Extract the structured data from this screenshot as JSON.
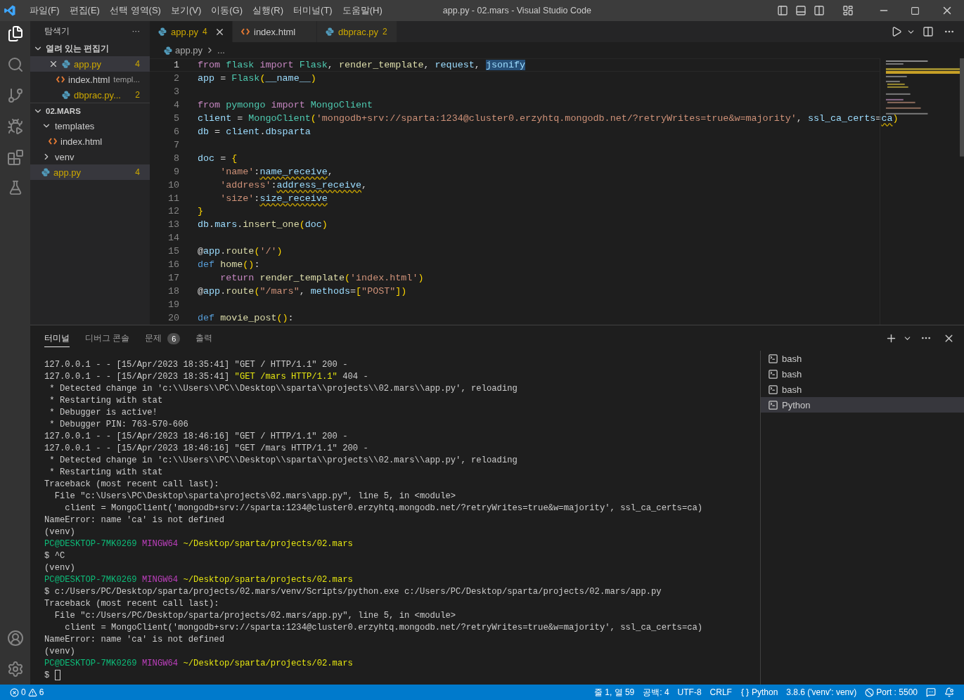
{
  "window": {
    "title": "app.py - 02.mars - Visual Studio Code"
  },
  "menu": [
    "파일(F)",
    "편집(E)",
    "선택 영역(S)",
    "보기(V)",
    "이동(G)",
    "실행(R)",
    "터미널(T)",
    "도움말(H)"
  ],
  "sidebar": {
    "title": "탐색기",
    "more": "···",
    "open_editors": {
      "title": "열려 있는 편집기",
      "expanded": true,
      "items": [
        {
          "label": "app.py",
          "kind": "python",
          "badge": "4",
          "warning": true,
          "closable": true,
          "selected": true
        },
        {
          "label": "index.html",
          "kind": "html",
          "description": "templ...",
          "warning": false,
          "closable": false,
          "selected": false
        },
        {
          "label": "dbprac.py...",
          "kind": "python",
          "badge": "2",
          "warning": true,
          "closable": false,
          "selected": false
        }
      ]
    },
    "folder": {
      "title": "02.MARS",
      "expanded": true,
      "items": [
        {
          "label": "templates",
          "kind": "folder",
          "expanded": true,
          "warning": false,
          "selected": false,
          "children": [
            {
              "label": "index.html",
              "kind": "html",
              "warning": false,
              "selected": false
            }
          ]
        },
        {
          "label": "venv",
          "kind": "folder",
          "expanded": false,
          "warning": false,
          "selected": false
        },
        {
          "label": "app.py",
          "kind": "python",
          "badge": "4",
          "warning": true,
          "selected": true
        }
      ]
    }
  },
  "tabs": [
    {
      "label": "app.py",
      "kind": "python",
      "badge": "4",
      "warning": true,
      "selected": true
    },
    {
      "label": "index.html",
      "kind": "html",
      "warning": false,
      "selected": false
    },
    {
      "label": "dbprac.py",
      "kind": "python",
      "badge": "2",
      "warning": true,
      "selected": false
    }
  ],
  "breadcrumb": [
    "app.py",
    "..."
  ],
  "code": [
    {
      "number": "1",
      "current": true,
      "tokens": [
        {
          "kind": "kw",
          "text": "from "
        },
        {
          "kind": "cls",
          "text": "flask "
        },
        {
          "kind": "kw",
          "text": "import "
        },
        {
          "kind": "cls",
          "text": "Flask"
        },
        {
          "kind": "plain",
          "text": ", "
        },
        {
          "kind": "fn",
          "text": "render_template"
        },
        {
          "kind": "plain",
          "text": ", "
        },
        {
          "kind": "var",
          "text": "request"
        },
        {
          "kind": "plain",
          "text": ", "
        },
        {
          "kind": "sel",
          "text": "jsonify"
        }
      ]
    },
    {
      "number": "2",
      "current": false,
      "tokens": [
        {
          "kind": "var",
          "text": "app"
        },
        {
          "kind": "plain",
          "text": " = "
        },
        {
          "kind": "cls",
          "text": "Flask"
        },
        {
          "kind": "brace",
          "text": "("
        },
        {
          "kind": "var",
          "text": "__name__"
        },
        {
          "kind": "brace",
          "text": ")"
        }
      ]
    },
    {
      "number": "3",
      "current": false
    },
    {
      "number": "4",
      "current": false,
      "tokens": [
        {
          "kind": "kw",
          "text": "from "
        },
        {
          "kind": "cls",
          "text": "pymongo "
        },
        {
          "kind": "kw",
          "text": "import "
        },
        {
          "kind": "cls",
          "text": "MongoClient"
        }
      ]
    },
    {
      "number": "5",
      "current": false,
      "tokens": [
        {
          "kind": "var",
          "text": "client"
        },
        {
          "kind": "plain",
          "text": " = "
        },
        {
          "kind": "cls",
          "text": "MongoClient"
        },
        {
          "kind": "brace",
          "text": "("
        },
        {
          "kind": "str",
          "text": "'mongodb+srv://sparta:1234@cluster0.erzyhtq.mongodb.net/?retryWrites=true&w=majority'"
        },
        {
          "kind": "plain",
          "text": ", "
        },
        {
          "kind": "var",
          "text": "ssl_ca_certs"
        },
        {
          "kind": "plain",
          "text": "="
        },
        {
          "kind": "warn",
          "text": "ca"
        },
        {
          "kind": "brace",
          "text": ")"
        }
      ]
    },
    {
      "number": "6",
      "current": false,
      "tokens": [
        {
          "kind": "var",
          "text": "db"
        },
        {
          "kind": "plain",
          "text": " = "
        },
        {
          "kind": "var",
          "text": "client"
        },
        {
          "kind": "plain",
          "text": "."
        },
        {
          "kind": "var",
          "text": "dbsparta"
        }
      ]
    },
    {
      "number": "7",
      "current": false
    },
    {
      "number": "8",
      "current": false,
      "tokens": [
        {
          "kind": "var",
          "text": "doc"
        },
        {
          "kind": "plain",
          "text": " = "
        },
        {
          "kind": "brace",
          "text": "{"
        }
      ]
    },
    {
      "number": "9",
      "current": false,
      "tokens": [
        {
          "kind": "str",
          "text": "    'name'"
        },
        {
          "kind": "plain",
          "text": ":"
        },
        {
          "kind": "warn",
          "text": "name_receive"
        },
        {
          "kind": "plain",
          "text": ","
        }
      ]
    },
    {
      "number": "10",
      "current": false,
      "tokens": [
        {
          "kind": "str",
          "text": "    'address'"
        },
        {
          "kind": "plain",
          "text": ":"
        },
        {
          "kind": "warn",
          "text": "address_receive"
        },
        {
          "kind": "plain",
          "text": ","
        }
      ]
    },
    {
      "number": "11",
      "current": false,
      "tokens": [
        {
          "kind": "str",
          "text": "    'size'"
        },
        {
          "kind": "plain",
          "text": ":"
        },
        {
          "kind": "warn",
          "text": "size_receive"
        }
      ]
    },
    {
      "number": "12",
      "current": false,
      "tokens": [
        {
          "kind": "brace",
          "text": "}"
        }
      ]
    },
    {
      "number": "13",
      "current": false,
      "tokens": [
        {
          "kind": "var",
          "text": "db"
        },
        {
          "kind": "plain",
          "text": "."
        },
        {
          "kind": "var",
          "text": "mars"
        },
        {
          "kind": "plain",
          "text": "."
        },
        {
          "kind": "fn",
          "text": "insert_one"
        },
        {
          "kind": "brace",
          "text": "("
        },
        {
          "kind": "var",
          "text": "doc"
        },
        {
          "kind": "brace",
          "text": ")"
        }
      ]
    },
    {
      "number": "14",
      "current": false
    },
    {
      "number": "15",
      "current": false,
      "tokens": [
        {
          "kind": "plain",
          "text": "@"
        },
        {
          "kind": "var",
          "text": "app"
        },
        {
          "kind": "plain",
          "text": "."
        },
        {
          "kind": "fn",
          "text": "route"
        },
        {
          "kind": "brace",
          "text": "("
        },
        {
          "kind": "str",
          "text": "'/'"
        },
        {
          "kind": "brace",
          "text": ")"
        }
      ]
    },
    {
      "number": "16",
      "current": false,
      "tokens": [
        {
          "kind": "def",
          "text": "def "
        },
        {
          "kind": "fn",
          "text": "home"
        },
        {
          "kind": "brace",
          "text": "()"
        },
        {
          "kind": "plain",
          "text": ":"
        }
      ]
    },
    {
      "number": "17",
      "current": false,
      "tokens": [
        {
          "kind": "kw",
          "text": "    return "
        },
        {
          "kind": "fn",
          "text": "render_template"
        },
        {
          "kind": "brace",
          "text": "("
        },
        {
          "kind": "str",
          "text": "'index.html'"
        },
        {
          "kind": "brace",
          "text": ")"
        }
      ]
    },
    {
      "number": "18",
      "current": false,
      "tokens": [
        {
          "kind": "plain",
          "text": "@"
        },
        {
          "kind": "var",
          "text": "app"
        },
        {
          "kind": "plain",
          "text": "."
        },
        {
          "kind": "fn",
          "text": "route"
        },
        {
          "kind": "brace",
          "text": "("
        },
        {
          "kind": "str",
          "text": "\"/mars\""
        },
        {
          "kind": "plain",
          "text": ", "
        },
        {
          "kind": "var",
          "text": "methods"
        },
        {
          "kind": "plain",
          "text": "="
        },
        {
          "kind": "brace",
          "text": "["
        },
        {
          "kind": "str",
          "text": "\"POST\""
        },
        {
          "kind": "brace",
          "text": "])"
        }
      ]
    },
    {
      "number": "19",
      "current": false
    },
    {
      "number": "20",
      "current": false,
      "tokens": [
        {
          "kind": "def",
          "text": "def "
        },
        {
          "kind": "fn",
          "text": "movie_post"
        },
        {
          "kind": "brace",
          "text": "()"
        },
        {
          "kind": "plain",
          "text": ":"
        }
      ]
    }
  ],
  "panel": {
    "tabs": [
      {
        "label": "터미널",
        "selected": true
      },
      {
        "label": "디버그 콘솔",
        "selected": false
      },
      {
        "label": "문제",
        "badge": "6",
        "selected": false
      },
      {
        "label": "출력",
        "selected": false
      }
    ],
    "terminal": [
      [
        {
          "kind": "plain",
          "text": "127.0.0.1 - - [15/Apr/2023 18:35:41] \"GET / HTTP/1.1\" 200 -"
        }
      ],
      [
        {
          "kind": "plain",
          "text": "127.0.0.1 - - [15/Apr/2023 18:35:41] "
        },
        {
          "kind": "highlight",
          "text": "\"GET /mars HTTP/1.1\""
        },
        {
          "kind": "plain",
          "text": " 404 -"
        }
      ],
      [
        {
          "kind": "plain",
          "text": " * Detected change in 'c:\\\\Users\\\\PC\\\\Desktop\\\\sparta\\\\projects\\\\02.mars\\\\app.py', reloading"
        }
      ],
      [
        {
          "kind": "plain",
          "text": " * Restarting with stat"
        }
      ],
      [
        {
          "kind": "plain",
          "text": " * Debugger is active!"
        }
      ],
      [
        {
          "kind": "plain",
          "text": " * Debugger PIN: 763-570-606"
        }
      ],
      [
        {
          "kind": "plain",
          "text": "127.0.0.1 - - [15/Apr/2023 18:46:16] \"GET / HTTP/1.1\" 200 -"
        }
      ],
      [
        {
          "kind": "plain",
          "text": "127.0.0.1 - - [15/Apr/2023 18:46:16] \"GET /mars HTTP/1.1\" 200 -"
        }
      ],
      [
        {
          "kind": "plain",
          "text": " * Detected change in 'c:\\\\Users\\\\PC\\\\Desktop\\\\sparta\\\\projects\\\\02.mars\\\\app.py', reloading"
        }
      ],
      [
        {
          "kind": "plain",
          "text": " * Restarting with stat"
        }
      ],
      [
        {
          "kind": "plain",
          "text": "Traceback (most recent call last):"
        }
      ],
      [
        {
          "kind": "plain",
          "text": "  File \"c:\\Users\\PC\\Desktop\\sparta\\projects\\02.mars\\app.py\", line 5, in <module>"
        }
      ],
      [
        {
          "kind": "plain",
          "text": "    client = MongoClient('mongodb+srv://sparta:1234@cluster0.erzyhtq.mongodb.net/?retryWrites=true&w=majority', ssl_ca_certs=ca)"
        }
      ],
      [
        {
          "kind": "plain",
          "text": "NameError: name 'ca' is not defined"
        }
      ],
      [
        {
          "kind": "plain",
          "text": "(venv)"
        }
      ],
      [
        {
          "kind": "user",
          "text": "PC@DESKTOP-7MK0269 "
        },
        {
          "kind": "shell",
          "text": "MINGW64 "
        },
        {
          "kind": "path",
          "text": "~/Desktop/sparta/projects/02.mars"
        }
      ],
      [
        {
          "kind": "plain",
          "text": "$ ^C"
        }
      ],
      [
        {
          "kind": "plain",
          "text": "(venv)"
        }
      ],
      [
        {
          "kind": "user",
          "text": "PC@DESKTOP-7MK0269 "
        },
        {
          "kind": "shell",
          "text": "MINGW64 "
        },
        {
          "kind": "path",
          "text": "~/Desktop/sparta/projects/02.mars"
        }
      ],
      [
        {
          "kind": "plain",
          "text": "$ c:/Users/PC/Desktop/sparta/projects/02.mars/venv/Scripts/python.exe c:/Users/PC/Desktop/sparta/projects/02.mars/app.py"
        }
      ],
      [
        {
          "kind": "plain",
          "text": "Traceback (most recent call last):"
        }
      ],
      [
        {
          "kind": "plain",
          "text": "  File \"c:/Users/PC/Desktop/sparta/projects/02.mars/app.py\", line 5, in <module>"
        }
      ],
      [
        {
          "kind": "plain",
          "text": "    client = MongoClient('mongodb+srv://sparta:1234@cluster0.erzyhtq.mongodb.net/?retryWrites=true&w=majority', ssl_ca_certs=ca)"
        }
      ],
      [
        {
          "kind": "plain",
          "text": "NameError: name 'ca' is not defined"
        }
      ],
      [
        {
          "kind": "plain",
          "text": "(venv)"
        }
      ],
      [
        {
          "kind": "user",
          "text": "PC@DESKTOP-7MK0269 "
        },
        {
          "kind": "shell",
          "text": "MINGW64 "
        },
        {
          "kind": "path",
          "text": "~/Desktop/sparta/projects/02.mars"
        }
      ],
      [
        {
          "kind": "plain",
          "text": "$ "
        },
        {
          "kind": "cursor"
        }
      ]
    ],
    "terminals": [
      {
        "label": "bash",
        "selected": false
      },
      {
        "label": "bash",
        "selected": false
      },
      {
        "label": "bash",
        "selected": false
      },
      {
        "label": "Python",
        "selected": true
      }
    ]
  },
  "status_bar": {
    "errors": "0",
    "warnings": "6",
    "right": [
      {
        "kind": "text",
        "text": "줄 1, 열 59"
      },
      {
        "kind": "text",
        "text": "공백: 4"
      },
      {
        "kind": "text",
        "text": "UTF-8"
      },
      {
        "kind": "text",
        "text": "CRLF"
      },
      {
        "kind": "language",
        "text": "Python"
      },
      {
        "kind": "text",
        "text": "3.8.6 ('venv': venv)"
      },
      {
        "kind": "port",
        "text": "Port : 5500"
      }
    ]
  }
}
